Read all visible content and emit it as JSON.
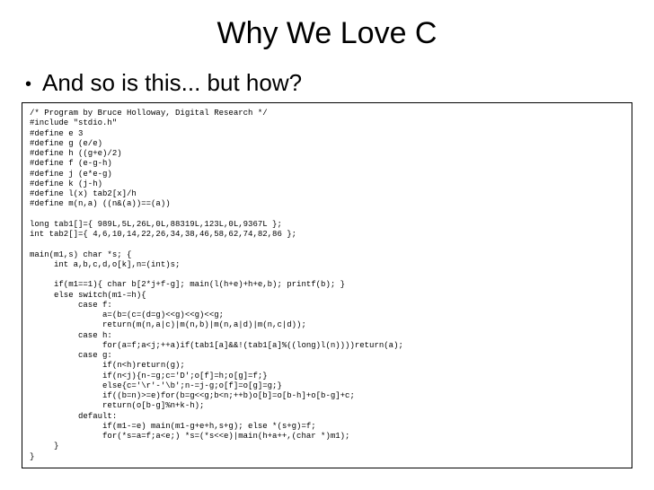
{
  "title": "Why We Love C",
  "bullet": "And so is this... but how?",
  "code": "/* Program by Bruce Holloway, Digital Research */\n#include \"stdio.h\"\n#define e 3\n#define g (e/e)\n#define h ((g+e)/2)\n#define f (e-g-h)\n#define j (e*e-g)\n#define k (j-h)\n#define l(x) tab2[x]/h\n#define m(n,a) ((n&(a))==(a))\n\nlong tab1[]={ 989L,5L,26L,0L,88319L,123L,0L,9367L };\nint tab2[]={ 4,6,10,14,22,26,34,38,46,58,62,74,82,86 };\n\nmain(m1,s) char *s; {\n     int a,b,c,d,o[k],n=(int)s;\n\n     if(m1==1){ char b[2*j+f-g]; main(l(h+e)+h+e,b); printf(b); }\n     else switch(m1-=h){\n          case f:\n               a=(b=(c=(d=g)<<g)<<g)<<g;\n               return(m(n,a|c)|m(n,b)|m(n,a|d)|m(n,c|d));\n          case h:\n               for(a=f;a<j;++a)if(tab1[a]&&!(tab1[a]%((long)l(n))))return(a);\n          case g:\n               if(n<h)return(g);\n               if(n<j){n-=g;c='D';o[f]=h;o[g]=f;}\n               else{c='\\r'-'\\b';n-=j-g;o[f]=o[g]=g;}\n               if((b=n)>=e)for(b=g<<g;b<n;++b)o[b]=o[b-h]+o[b-g]+c;\n               return(o[b-g]%n+k-h);\n          default:\n               if(m1-=e) main(m1-g+e+h,s+g); else *(s+g)=f;\n               for(*s=a=f;a<e;) *s=(*s<<e)|main(h+a++,(char *)m1);\n     }\n}"
}
